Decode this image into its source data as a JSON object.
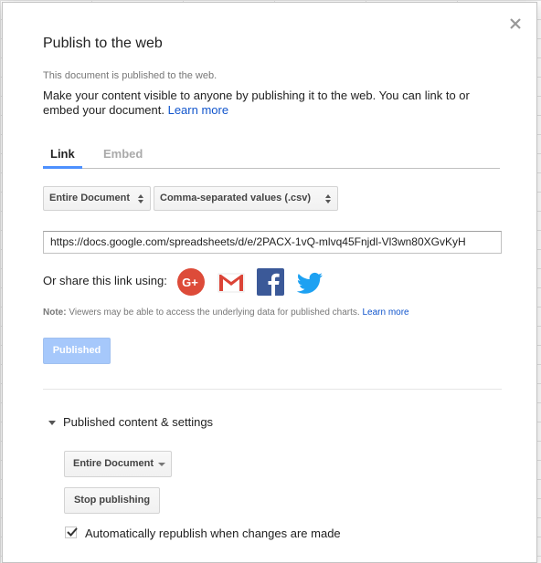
{
  "dialog": {
    "title": "Publish to the web",
    "published_note": "This document is published to the web.",
    "description": "Make your content visible to anyone by publishing it to the web. You can link to or embed your document.",
    "description_link": "Learn more",
    "close_icon": "close-icon"
  },
  "tabs": [
    {
      "label": "Link",
      "active": true
    },
    {
      "label": "Embed",
      "active": false
    }
  ],
  "publish_options": {
    "range": "Entire Document",
    "format": "Comma-separated values (.csv)"
  },
  "link": {
    "url": "https://docs.google.com/spreadsheets/d/e/2PACX-1vQ-mlvq45Fnjdl-Vl3wn80XGvKyH"
  },
  "share": {
    "label": "Or share this link using:",
    "icons": [
      "google-plus-icon",
      "gmail-icon",
      "facebook-icon",
      "twitter-icon"
    ]
  },
  "note": {
    "prefix": "Note:",
    "text": "Viewers may be able to access the underlying data for published charts.",
    "link": "Learn more"
  },
  "published_button": "Published",
  "settings": {
    "toggle_label": "Published content & settings",
    "range_dropdown": "Entire Document",
    "stop_button": "Stop publishing",
    "auto_republish_label": "Automatically republish when changes are made",
    "auto_republish_checked": true
  },
  "colors": {
    "accent": "#4d90fe",
    "link": "#1155cc",
    "published_button_bg": "#a6c8fb"
  }
}
